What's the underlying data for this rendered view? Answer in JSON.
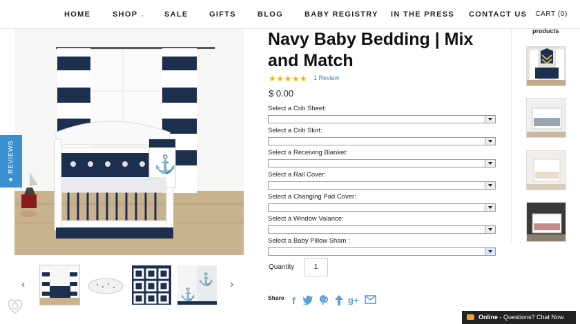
{
  "nav": {
    "items": [
      "HOME",
      "SHOP",
      "SALE",
      "GIFTS",
      "BLOG",
      "BABY REGISTRY",
      "IN THE PRESS",
      "CONTACT US"
    ],
    "shop_caret": "⌄",
    "cart": "CART (0)"
  },
  "reviews_tab": "★ REVIEWS",
  "product": {
    "title": "Navy Baby Bedding | Mix and Match",
    "stars": "★★★★★",
    "reviews": "1 Review",
    "price": "$ 0.00",
    "options": [
      "Select a Crib Sheet:",
      "Select a Crib Skirt:",
      "Select a Receiving Blanket:",
      "Select a Rail Cover:",
      "Select a Changing Pad Cover:",
      "Select a Window Valance:",
      "Select a Baby Pillow Sham :"
    ],
    "quantity_label": "Quantity",
    "quantity_value": "1",
    "share_label": "Share"
  },
  "thumbs": {
    "prev": "‹",
    "next": "›"
  },
  "related": {
    "title": "products"
  },
  "chat": {
    "status": "Online",
    "text": " - Questions? Chat Now"
  },
  "colors": {
    "accent": "#3a8fd1",
    "navy": "#1c2f4f",
    "star": "#f5b800",
    "chat_bg": "#222222"
  }
}
